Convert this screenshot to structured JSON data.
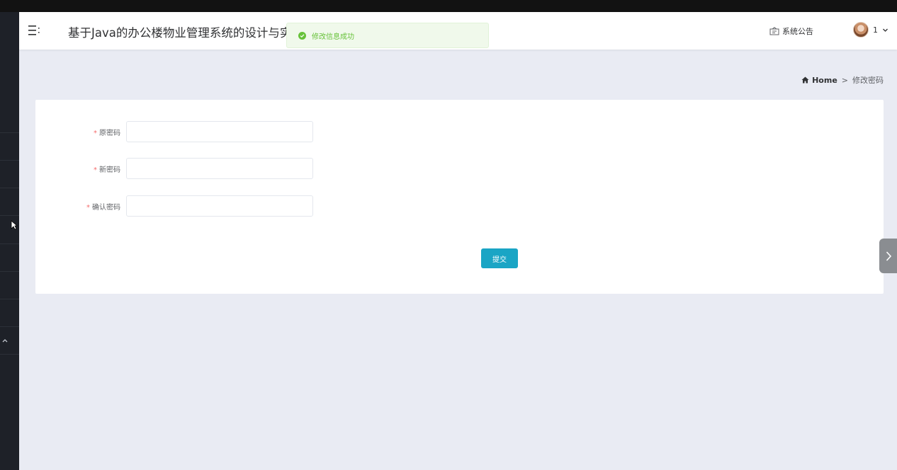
{
  "header": {
    "title": "基于Java的办公楼物业管理系统的设计与实",
    "notice_label": "系统公告",
    "user_name": "1"
  },
  "toast": {
    "message": "修改信息成功",
    "color": "#67c23a"
  },
  "breadcrumb": {
    "home": "Home",
    "separator": ">",
    "current": "修改密码"
  },
  "form": {
    "fields": [
      {
        "label": "原密码",
        "required_mark": "*",
        "value": ""
      },
      {
        "label": "新密码",
        "required_mark": "*",
        "value": ""
      },
      {
        "label": "确认密码",
        "required_mark": "*",
        "value": ""
      }
    ],
    "submit_label": "提交"
  },
  "colors": {
    "accent": "#1aa5c5",
    "success": "#67c23a",
    "sidebar": "#1e2128"
  }
}
